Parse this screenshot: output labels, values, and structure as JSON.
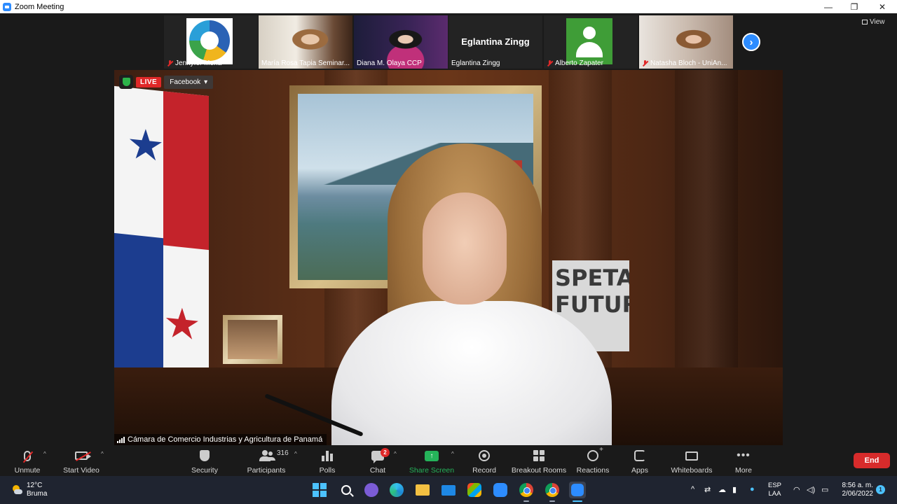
{
  "window": {
    "title": "Zoom Meeting",
    "controls": {
      "minimize": "—",
      "restore": "❐",
      "close": "✕"
    }
  },
  "filmstrip": {
    "tiles": [
      {
        "name": "Jennyfer Mena",
        "muted": true,
        "kind": "logo"
      },
      {
        "name": "María Rosa Tapia Seminar...",
        "muted": false,
        "kind": "photo"
      },
      {
        "name": "Diana M. Olaya CCP",
        "muted": false,
        "kind": "photo"
      },
      {
        "name": "Eglantina Zingg",
        "muted": false,
        "kind": "name",
        "display_name": "Eglantina Zingg"
      },
      {
        "name": "Alberto Zapater",
        "muted": true,
        "kind": "avatar"
      },
      {
        "name": "Natasha Bloch - UniAn...",
        "muted": true,
        "kind": "photo"
      }
    ],
    "next_icon": "›",
    "view_label": "View"
  },
  "stage": {
    "live_label": "LIVE",
    "stream_target": "Facebook",
    "speaker_name": "Cámara de Comercio Industrias y Agricultura de Panamá",
    "sign_lines": [
      "SPETA",
      "FUTURO"
    ]
  },
  "toolbar": {
    "unmute": "Unmute",
    "start_video": "Start Video",
    "security": "Security",
    "participants": "Participants",
    "participants_count": "316",
    "polls": "Polls",
    "chat": "Chat",
    "chat_badge": "2",
    "share_screen": "Share Screen",
    "record": "Record",
    "breakout_rooms": "Breakout Rooms",
    "reactions": "Reactions",
    "apps": "Apps",
    "whiteboards": "Whiteboards",
    "more": "More",
    "more_glyph": "•••",
    "end": "End",
    "caret": "^",
    "share_arrow": "↑"
  },
  "taskbar": {
    "weather_temp": "12°C",
    "weather_condition": "Bruma",
    "lang_top": "ESP",
    "lang_bottom": "LAA",
    "time": "8:56 a. m.",
    "date": "2/06/2022",
    "notification_count": "1",
    "tray_chevron": "^",
    "colors": {
      "accent": "#4cc2ff",
      "zoom_blue": "#2d8cff",
      "end_red": "#d72b2b",
      "share_green": "#25b35a"
    }
  }
}
